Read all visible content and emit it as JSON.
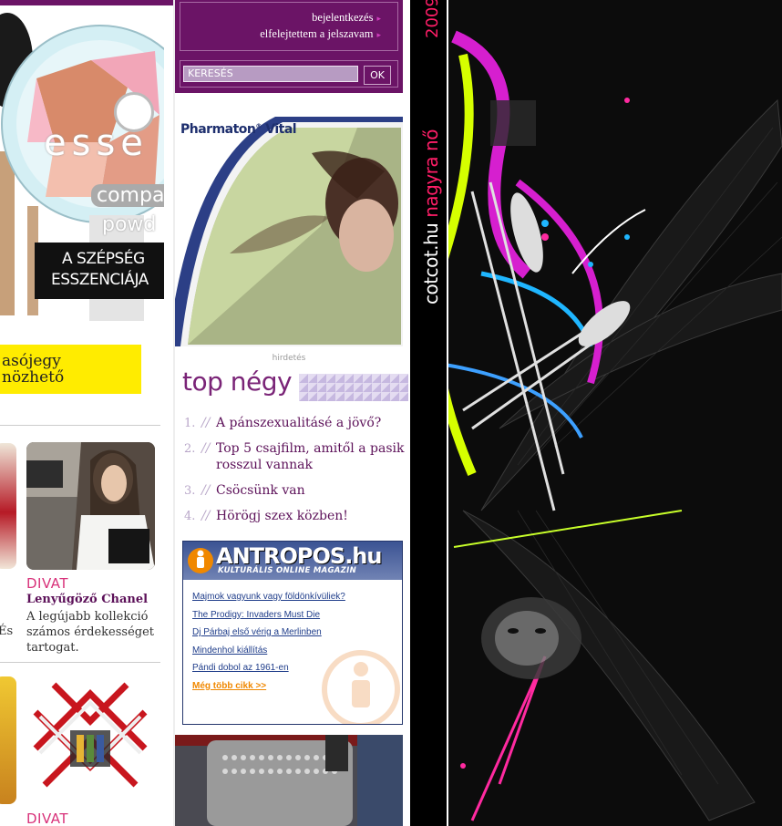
{
  "left": {
    "ad": {
      "brand": "esse",
      "line2": "compa",
      "line3": "powd",
      "slogan1": "A SZÉPSÉG",
      "slogan2": "ESSZENCIÁJA"
    },
    "yellow_box": {
      "line1": "asójegy",
      "line2": "nözhető"
    },
    "article1": {
      "category": "DIVAT",
      "title": "Lenyűgöző Chanel",
      "text1": "A legújabb kollekció",
      "text2": "számos érdekességet",
      "text3": "tartogat.",
      "edge_text": "És"
    },
    "article2": {
      "category": "DIVAT"
    }
  },
  "login": {
    "login_link": "bejelentkezés",
    "forgot_link": "elfelejtettem a jelszavam"
  },
  "search": {
    "value": "KERESÉS",
    "button": "OK"
  },
  "pharmaton": {
    "brand": "Pharmaton",
    "reg": "®",
    "name": "Vital"
  },
  "ad_label": "hirdetés",
  "top_negy": {
    "title": "top négy",
    "items": [
      {
        "num": "1.",
        "text": "A pánszexualitásé a jövő?"
      },
      {
        "num": "2.",
        "text": "Top 5 csajfilm, amitől a pasik rosszul vannak"
      },
      {
        "num": "3.",
        "text": "Csöcsünk van"
      },
      {
        "num": "4.",
        "text": "Hörögj szex közben!"
      }
    ]
  },
  "antropos": {
    "logo": "ANTROPOS.hu",
    "subtitle": "KULTURÁLIS ONLINE MAGAZIN",
    "links": [
      "Majmok vagyunk vagy földönkívüliek?",
      "The Prodigy: Invaders Must Die",
      "Dj Párbaj első vérig a Merlinben",
      "Mindenhol kiállítás",
      "Pándi dobol az 1961-en"
    ],
    "more": "Még több cikk >>"
  },
  "brand_strip": {
    "site": "cotcot.hu",
    "tagline": "nagyra nő",
    "year": "2009"
  },
  "colors": {
    "purple": "#6b1466",
    "pink": "#ff1e68",
    "yellow": "#ffec00",
    "antropos_blue": "#24366c"
  }
}
